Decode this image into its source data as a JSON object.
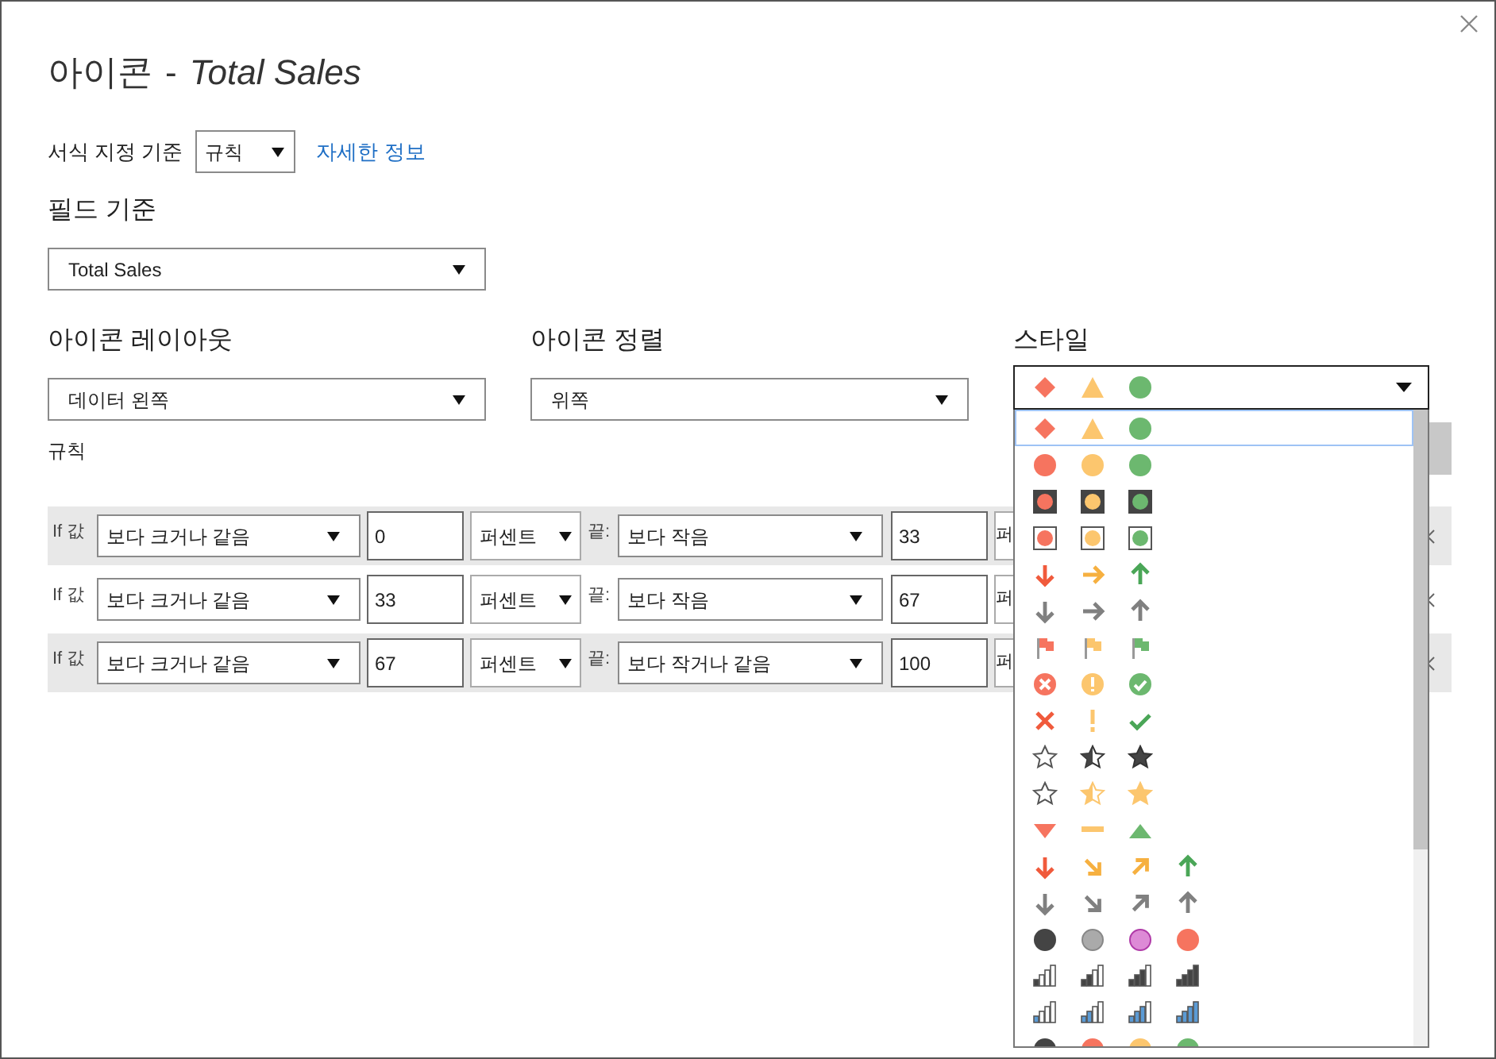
{
  "window": {
    "title": "아이콘",
    "separator": "-",
    "subtitle": "Total Sales"
  },
  "format_by": {
    "label": "서식 지정 기준",
    "value": "규칙",
    "link": "자세한 정보"
  },
  "based_on_field": {
    "label": "필드 기준",
    "value": "Total Sales"
  },
  "icon_layout": {
    "label": "아이콘 레이아웃",
    "value": "데이터 왼쪽"
  },
  "icon_alignment": {
    "label": "아이콘 정렬",
    "value": "위쪽"
  },
  "style": {
    "label": "스타일",
    "expanded": true,
    "options": [
      {
        "kind": "shapes3",
        "selected": true
      },
      {
        "kind": "circles3",
        "selected": false
      },
      {
        "kind": "framed-dark3",
        "selected": false
      },
      {
        "kind": "framed-light3",
        "selected": false
      },
      {
        "kind": "arrows-color3",
        "selected": false
      },
      {
        "kind": "arrows-gray3",
        "selected": false
      },
      {
        "kind": "flags3",
        "selected": false
      },
      {
        "kind": "symbols-circled3",
        "selected": false
      },
      {
        "kind": "symbols3",
        "selected": false
      },
      {
        "kind": "stars-dark3",
        "selected": false
      },
      {
        "kind": "stars-gold3",
        "selected": false
      },
      {
        "kind": "triangles3",
        "selected": false
      },
      {
        "kind": "arrows-color4",
        "selected": false
      },
      {
        "kind": "arrows-gray4",
        "selected": false
      },
      {
        "kind": "circles-mixed4",
        "selected": false
      },
      {
        "kind": "bars-dark4",
        "selected": false
      },
      {
        "kind": "bars-blue4",
        "selected": false
      },
      {
        "kind": "circles4",
        "selected": false
      }
    ]
  },
  "rules_label": "규칙",
  "rules": [
    {
      "if_label": "If 값",
      "operator": "보다 크거나 같음",
      "value": "0",
      "unit": "퍼센트",
      "end_label": "끝:",
      "end_operator": "보다 작음",
      "end_value": "33",
      "end_unit": "퍼",
      "highlighted": true
    },
    {
      "if_label": "If 값",
      "operator": "보다 크거나 같음",
      "value": "33",
      "unit": "퍼센트",
      "end_label": "끝:",
      "end_operator": "보다 작음",
      "end_value": "67",
      "end_unit": "퍼",
      "highlighted": false
    },
    {
      "if_label": "If 값",
      "operator": "보다 크거나 같음",
      "value": "67",
      "unit": "퍼센트",
      "end_label": "끝:",
      "end_operator": "보다 작거나 같음",
      "end_value": "100",
      "end_unit": "퍼",
      "highlighted": true
    }
  ]
}
